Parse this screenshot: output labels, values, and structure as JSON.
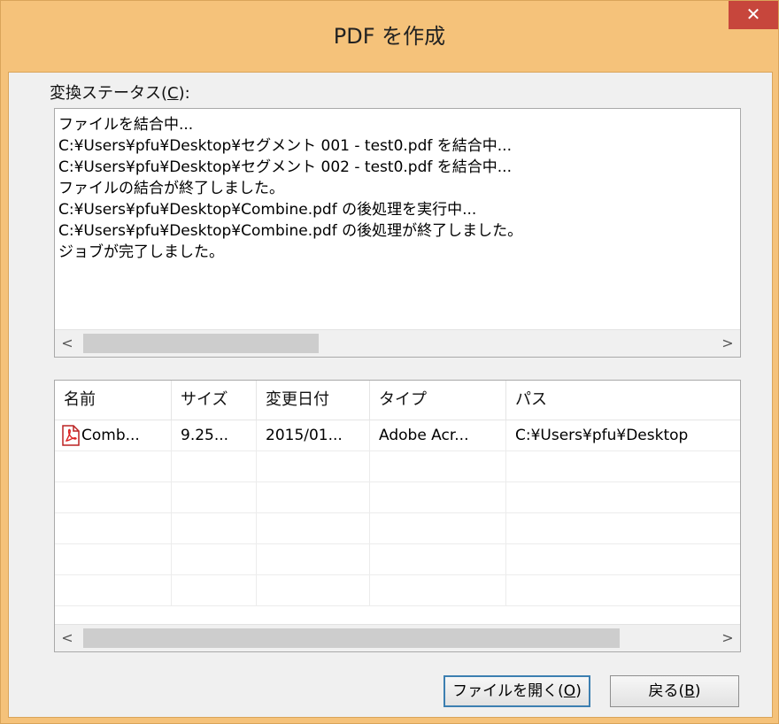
{
  "window": {
    "title": "PDF を作成",
    "close_glyph": "✕"
  },
  "status": {
    "label": "変換ステータス(",
    "label_mnemonic": "C",
    "label_suffix": "):",
    "lines": [
      "ファイルを結合中...",
      "C:¥Users¥pfu¥Desktop¥セグメント 001 - test0.pdf を結合中...",
      "C:¥Users¥pfu¥Desktop¥セグメント 002 - test0.pdf を結合中...",
      "ファイルの結合が終了しました。",
      "C:¥Users¥pfu¥Desktop¥Combine.pdf の後処理を実行中...",
      "C:¥Users¥pfu¥Desktop¥Combine.pdf の後処理が終了しました。",
      "ジョブが完了しました。"
    ]
  },
  "file_list": {
    "columns": [
      "名前",
      "サイズ",
      "変更日付",
      "タイプ",
      "パス"
    ],
    "rows": [
      {
        "icon": "pdf-file-icon",
        "name": "Comb...",
        "size": "9.25...",
        "modified": "2015/01...",
        "type": "Adobe Acr...",
        "path": "C:¥Users¥pfu¥Desktop"
      }
    ]
  },
  "scroll_glyphs": {
    "left": "<",
    "right": ">"
  },
  "buttons": {
    "open_file": "ファイルを開く(",
    "open_file_mnemonic": "O",
    "open_file_suffix": ")",
    "back": "戻る(",
    "back_mnemonic": "B",
    "back_suffix": ")"
  },
  "colors": {
    "frame": "#f5c27a",
    "close": "#c7463c",
    "default_button_border": "#3c7fb1"
  }
}
